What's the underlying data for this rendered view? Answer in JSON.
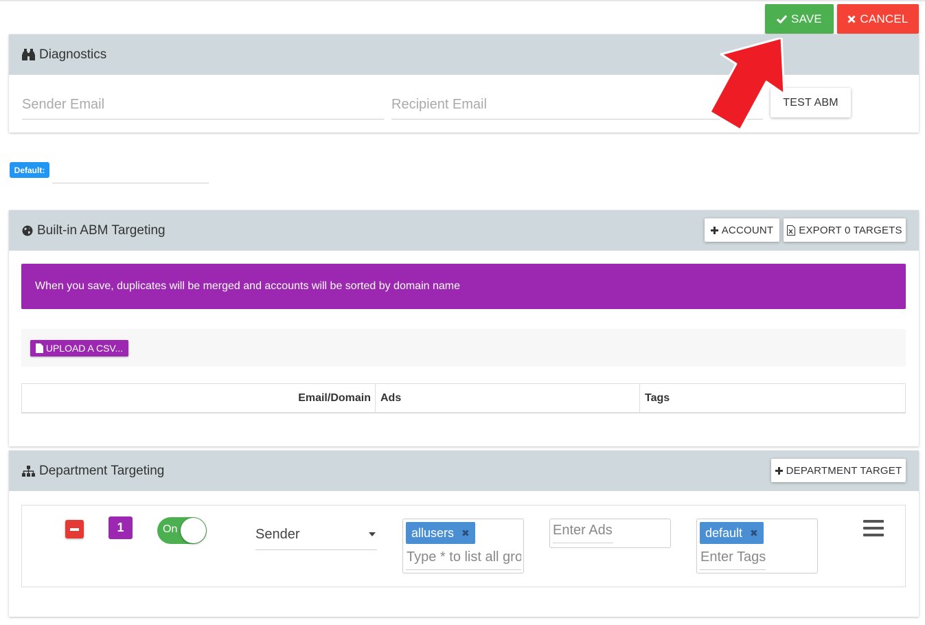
{
  "toolbar": {
    "save_label": "SAVE",
    "cancel_label": "CANCEL"
  },
  "diagnostics": {
    "title": "Diagnostics",
    "sender_placeholder": "Sender Email",
    "recipient_placeholder": "Recipient Email",
    "test_button": "TEST ABM"
  },
  "default": {
    "badge": "Default:"
  },
  "abm": {
    "title": "Built-in ABM Targeting",
    "account_button": "ACCOUNT",
    "export_button": "EXPORT 0 TARGETS",
    "alert": "When you save, duplicates will be merged and accounts will be sorted by domain name",
    "upload_button": "UPLOAD A CSV...",
    "columns": [
      "Email/Domain",
      "Ads",
      "Tags"
    ]
  },
  "department": {
    "title": "Department Targeting",
    "add_button": "DEPARTMENT TARGET",
    "row": {
      "number": "1",
      "toggle_label": "On",
      "select_value": "Sender",
      "group_chip": "allusers",
      "group_placeholder": "Type * to list all groups",
      "ads_placeholder": "Enter Ads",
      "tag_chip": "default",
      "tags_placeholder": "Enter Tags"
    }
  },
  "colors": {
    "save": "#4caf50",
    "cancel": "#f44336",
    "panel_header": "#cfd8dc",
    "purple": "#9c27b0",
    "badge_blue": "#2196f3",
    "chip_blue": "#4a8fd4",
    "arrow_red": "#ee1c25"
  }
}
